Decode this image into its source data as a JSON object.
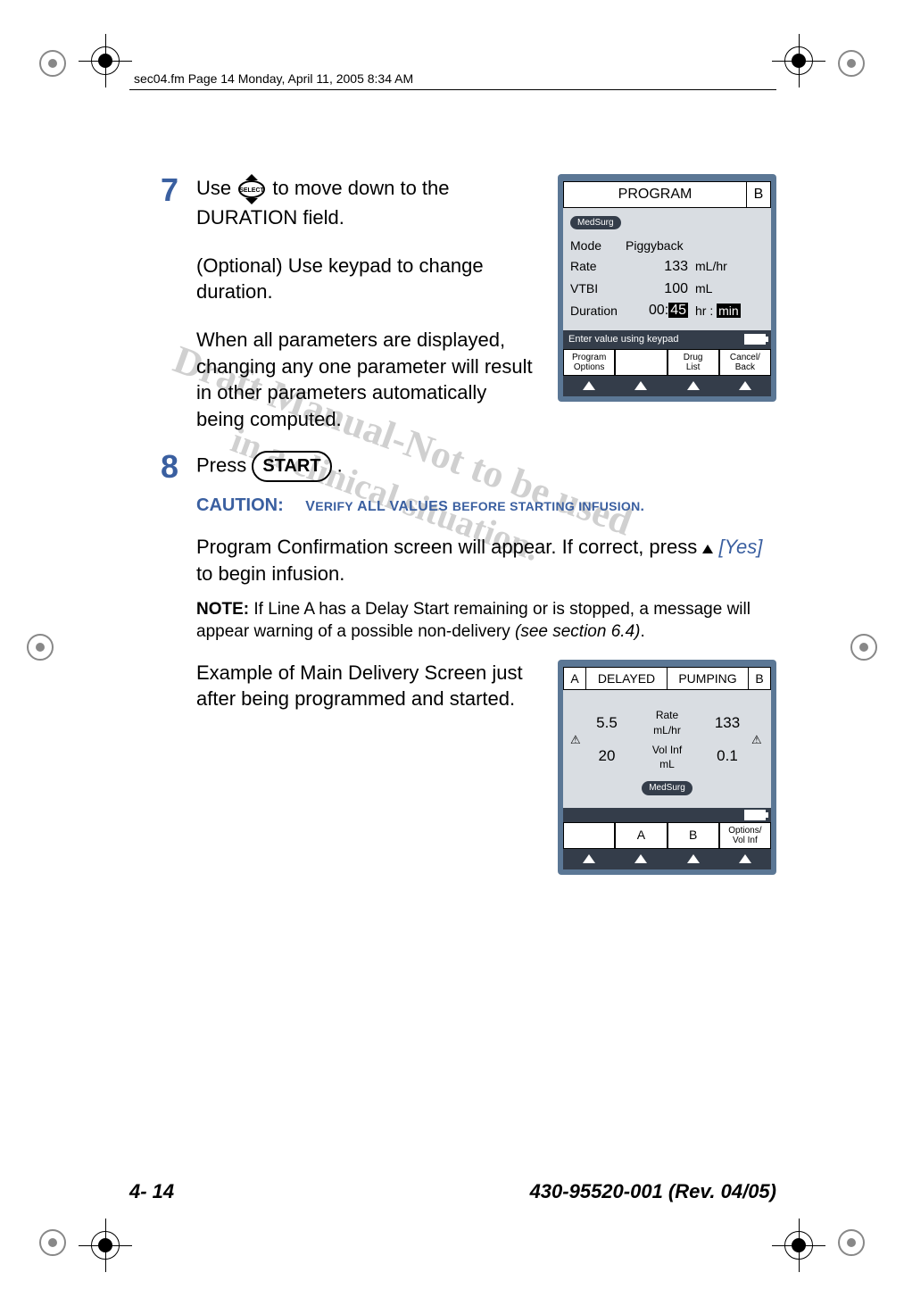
{
  "header": {
    "line": "sec04.fm  Page 14  Monday, April 11, 2005  8:34 AM"
  },
  "watermark": {
    "line1": "Draft Manual-Not to be used",
    "line2": "in a clinical situation."
  },
  "step7": {
    "num": "7",
    "p1a": "Use ",
    "p1b": " to move down to the DURATION field.",
    "p2": "(Optional) Use keypad to change duration.",
    "p3": "When all parameters are displayed, changing any one parameter will result in other parameters automatically being computed."
  },
  "step8": {
    "num": "8",
    "p1a": "Press ",
    "start": "START",
    "p1b": " .",
    "caution_label": "CAUTION:",
    "caution_text": "Verify ALL VALUES before starting infusion.",
    "p2a": "Program Confirmation screen will appear. If correct, press ",
    "yes": "[Yes]",
    "p2b": " to begin infusion.",
    "note_label": "NOTE:",
    "note_text_a": " If Line A has a Delay Start remaining or is stopped, a message will appear warning of a possible non-delivery ",
    "note_text_b": "(see section 6.4)",
    "note_text_c": ".",
    "example": "Example of Main Delivery Screen just after being programmed and started."
  },
  "device1": {
    "title": "PROGRAM",
    "channel": "B",
    "cca": "MedSurg",
    "rows": {
      "mode_label": "Mode",
      "mode_val": "Piggyback",
      "rate_label": "Rate",
      "rate_val": "133",
      "rate_unit": "mL/hr",
      "vtbi_label": "VTBI",
      "vtbi_val": "100",
      "vtbi_unit": "mL",
      "dur_label": "Duration",
      "dur_hr": "00:",
      "dur_min": "45",
      "dur_unit_a": "hr : ",
      "dur_unit_b": "min"
    },
    "status": "Enter value using keypad",
    "softkeys": {
      "k1a": "Program",
      "k1b": "Options",
      "k2": "",
      "k3a": "Drug",
      "k3b": "List",
      "k4a": "Cancel/",
      "k4b": "Back"
    }
  },
  "device2": {
    "a": "A",
    "delayed": "DELAYED",
    "pumping": "PUMPING",
    "b": "B",
    "left_rate": "5.5",
    "left_vol": "20",
    "mid_rate_a": "Rate",
    "mid_rate_b": "mL/hr",
    "mid_vol_a": "Vol Inf",
    "mid_vol_b": "mL",
    "right_rate": "133",
    "right_vol": "0.1",
    "cca": "MedSurg",
    "softkeys": {
      "k1": "",
      "k2": "A",
      "k3": "B",
      "k4a": "Options/",
      "k4b": "Vol Inf"
    }
  },
  "footer": {
    "left": "4- 14",
    "right": "430-95520-001 (Rev. 04/05)"
  }
}
